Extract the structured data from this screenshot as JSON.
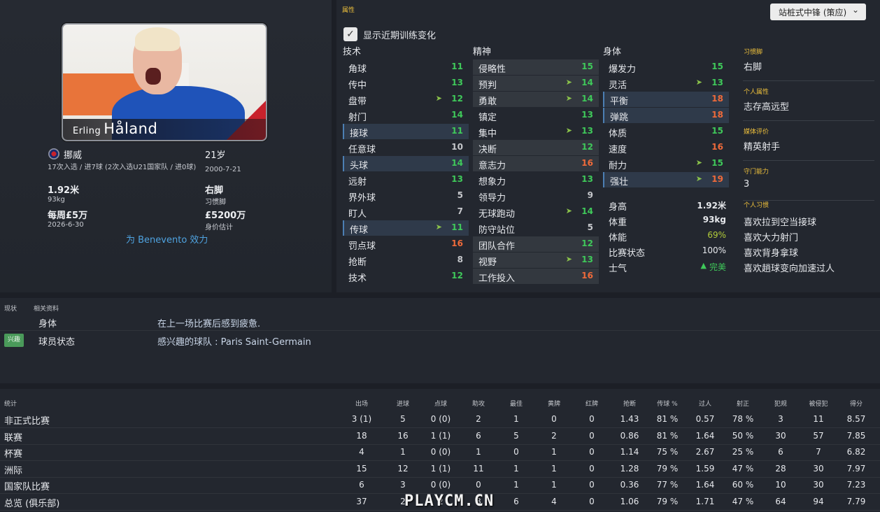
{
  "player": {
    "first_name": "Erling",
    "last_name": "Håland",
    "nation": "挪威",
    "caps_line": "17次入选 / 进7球 (2次入选U21国家队 / 进0球)",
    "age": "21岁",
    "dob": "2000-7-21",
    "height": "1.92米",
    "weight": "93kg",
    "foot": "右脚",
    "foot_label": "习惯脚",
    "wage": "每周£5万",
    "contract": "2026-6-30",
    "value": "£5200万",
    "value_label": "身价估计",
    "club_link": "为 Benevento 效力"
  },
  "attributes": {
    "panel_title": "属性",
    "role": "站桩式中锋 (策应)",
    "show_training_label": "显示近期训练变化",
    "technical_title": "技术",
    "mental_title": "精神",
    "physical_title": "身体",
    "technical": [
      {
        "label": "角球",
        "value": "11",
        "color": "g"
      },
      {
        "label": "传中",
        "value": "13",
        "color": "g"
      },
      {
        "label": "盘带",
        "value": "12",
        "color": "g",
        "arrow": true
      },
      {
        "label": "射门",
        "value": "14",
        "color": "g"
      },
      {
        "label": "接球",
        "value": "11",
        "color": "g"
      },
      {
        "label": "任意球",
        "value": "10",
        "color": "w"
      },
      {
        "label": "头球",
        "value": "14",
        "color": "g"
      },
      {
        "label": "远射",
        "value": "13",
        "color": "g"
      },
      {
        "label": "界外球",
        "value": "5",
        "color": "w"
      },
      {
        "label": "盯人",
        "value": "7",
        "color": "w"
      },
      {
        "label": "传球",
        "value": "11",
        "color": "g",
        "arrow": true
      },
      {
        "label": "罚点球",
        "value": "16",
        "color": "o"
      },
      {
        "label": "抢断",
        "value": "8",
        "color": "w"
      },
      {
        "label": "技术",
        "value": "12",
        "color": "g"
      }
    ],
    "mental": [
      {
        "label": "侵略性",
        "value": "15",
        "color": "g"
      },
      {
        "label": "预判",
        "value": "14",
        "color": "g",
        "arrow": true
      },
      {
        "label": "勇敢",
        "value": "14",
        "color": "g",
        "arrow": true
      },
      {
        "label": "镇定",
        "value": "13",
        "color": "g"
      },
      {
        "label": "集中",
        "value": "13",
        "color": "g",
        "arrow": true
      },
      {
        "label": "决断",
        "value": "12",
        "color": "g"
      },
      {
        "label": "意志力",
        "value": "16",
        "color": "o"
      },
      {
        "label": "想象力",
        "value": "13",
        "color": "g"
      },
      {
        "label": "领导力",
        "value": "9",
        "color": "w"
      },
      {
        "label": "无球跑动",
        "value": "14",
        "color": "g",
        "arrow": true
      },
      {
        "label": "防守站位",
        "value": "5",
        "color": "w"
      },
      {
        "label": "团队合作",
        "value": "12",
        "color": "g"
      },
      {
        "label": "视野",
        "value": "13",
        "color": "g",
        "arrow": true
      },
      {
        "label": "工作投入",
        "value": "16",
        "color": "o"
      }
    ],
    "physical": [
      {
        "label": "爆发力",
        "value": "15",
        "color": "g"
      },
      {
        "label": "灵活",
        "value": "13",
        "color": "g",
        "arrow": true
      },
      {
        "label": "平衡",
        "value": "18",
        "color": "o"
      },
      {
        "label": "弹跳",
        "value": "18",
        "color": "o"
      },
      {
        "label": "体质",
        "value": "15",
        "color": "g"
      },
      {
        "label": "速度",
        "value": "16",
        "color": "o"
      },
      {
        "label": "耐力",
        "value": "15",
        "color": "g",
        "arrow": true
      },
      {
        "label": "强壮",
        "value": "19",
        "color": "o",
        "arrow": true
      }
    ],
    "physical_stats": [
      {
        "label": "身高",
        "value": "1.92米"
      },
      {
        "label": "体重",
        "value": "93kg"
      },
      {
        "label": "体能",
        "value": "69%"
      },
      {
        "label": "比赛状态",
        "value": "100%"
      },
      {
        "label": "士气",
        "value": "完美"
      }
    ],
    "side": [
      {
        "title": "习惯脚",
        "value": "右脚"
      },
      {
        "title": "个人属性",
        "value": "志存高远型"
      },
      {
        "title": "媒体评价",
        "value": "精英射手"
      },
      {
        "title": "守门能力",
        "value": "3"
      }
    ],
    "habits_title": "个人习惯",
    "habits": [
      "喜欢拉到空当接球",
      "喜欢大力射门",
      "喜欢背身拿球",
      "喜欢趟球变向加速过人"
    ]
  },
  "status": {
    "tabs": [
      "现状",
      "相关资料"
    ],
    "rows": [
      {
        "label": "身体",
        "text": "在上一场比赛后感到疲惫."
      },
      {
        "label": "球员状态",
        "text": "感兴趣的球队 : Paris Saint-Germain"
      }
    ],
    "badge": "兴趣"
  },
  "stats": {
    "title": "统计",
    "headers": [
      "出场",
      "进球",
      "点球",
      "助攻",
      "最佳",
      "黄牌",
      "红牌",
      "抢断",
      "传球 %",
      "过人",
      "射正",
      "犯规",
      "被侵犯",
      "得分"
    ],
    "rows": [
      {
        "label": "非正式比赛",
        "cells": [
          "3 (1)",
          "5",
          "0 (0)",
          "2",
          "1",
          "0",
          "0",
          "1.43",
          "81 %",
          "0.57",
          "78 %",
          "3",
          "11",
          "8.57"
        ]
      },
      {
        "label": "联赛",
        "cells": [
          "18",
          "16",
          "1 (1)",
          "6",
          "5",
          "2",
          "0",
          "0.86",
          "81 %",
          "1.64",
          "50 %",
          "30",
          "57",
          "7.85"
        ]
      },
      {
        "label": "杯赛",
        "cells": [
          "4",
          "1",
          "0 (0)",
          "1",
          "0",
          "1",
          "0",
          "1.14",
          "75 %",
          "2.67",
          "25 %",
          "6",
          "7",
          "6.82"
        ]
      },
      {
        "label": "洲际",
        "cells": [
          "15",
          "12",
          "1 (1)",
          "11",
          "1",
          "1",
          "0",
          "1.28",
          "79 %",
          "1.59",
          "47 %",
          "28",
          "30",
          "7.97"
        ]
      },
      {
        "label": "国家队比赛",
        "cells": [
          "6",
          "3",
          "0 (0)",
          "0",
          "1",
          "1",
          "0",
          "0.36",
          "77 %",
          "1.64",
          "60 %",
          "10",
          "30",
          "7.23"
        ]
      },
      {
        "label": "总览 (俱乐部)",
        "cells": [
          "37",
          "2",
          "2",
          "8",
          "6",
          "4",
          "0",
          "1.06",
          "79 %",
          "1.71",
          "47 %",
          "64",
          "94",
          "7.79"
        ]
      }
    ]
  },
  "watermark": "PLAYCM.CN"
}
